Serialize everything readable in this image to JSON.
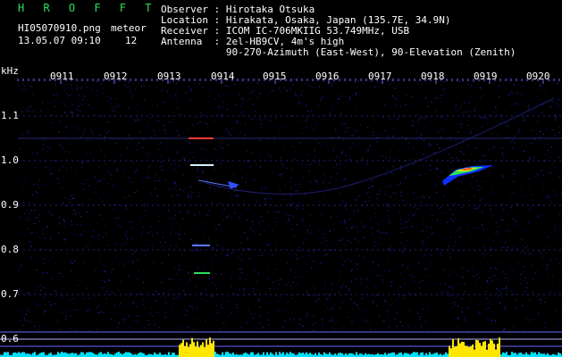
{
  "header": {
    "title": "H R O F F T",
    "filename": "HI05070910.png",
    "datetime": "13.05.07 09:10",
    "meteor_label": "meteor",
    "meteor_count": "12",
    "observer": "Observer : Hirotaka Otsuka",
    "location": "Location : Hirakata, Osaka, Japan (135.7E, 34.9N)",
    "receiver": "Receiver : ICOM IC-706MKIIG 53.749MHz, USB",
    "antenna": "Antenna  : 2el-HB9CV, 4m's high",
    "antenna2": "           90-270-Azimuth (East-West), 90-Elevation (Zenith)"
  },
  "axis": {
    "y_unit": "kHz",
    "y_ticks": [
      "1.1",
      "1.0",
      "0.9",
      "0.8",
      "0.7",
      "0.6"
    ],
    "x_ticks": [
      "0911",
      "0912",
      "0913",
      "0914",
      "0915",
      "0916",
      "0917",
      "0918",
      "0919",
      "0920"
    ]
  },
  "colors": {
    "background": "#000000",
    "grid": "#3a3ad0",
    "header_green": "#2ee05a",
    "meteor": "#ffe600",
    "level": "#00e0ff"
  }
}
